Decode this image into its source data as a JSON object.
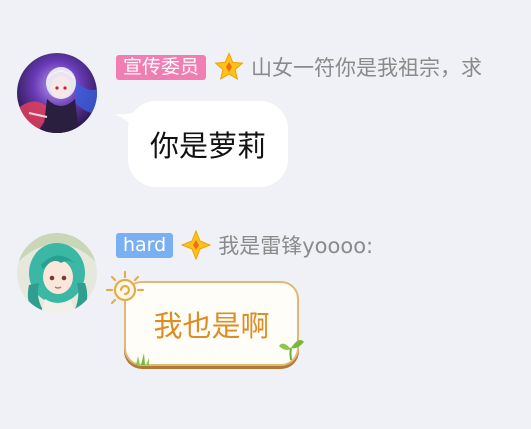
{
  "messages": [
    {
      "title": "宣传委员",
      "title_color": "#f07eb2",
      "level_icon": "star-badge-icon",
      "nickname": "山女一符你是我祖宗，求",
      "text": "你是萝莉",
      "bubble": "white"
    },
    {
      "title": "hard",
      "title_color": "#7ab0f2",
      "level_icon": "diamond-badge-icon",
      "nickname": "我是雷锋yoooo:",
      "text": "我也是啊",
      "bubble": "sun-decorated"
    }
  ]
}
